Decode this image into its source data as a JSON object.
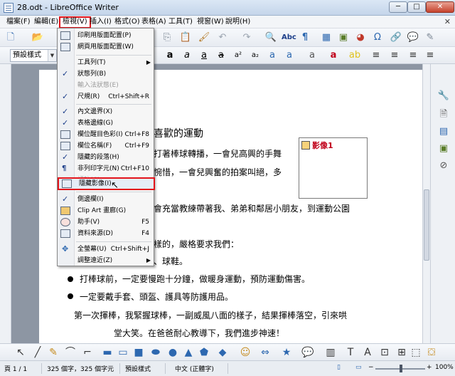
{
  "window": {
    "title": "28.odt - LibreOffice Writer",
    "minimize": "─",
    "maximize": "□",
    "close": "✕"
  },
  "menubar": {
    "items": [
      "檔案(F)",
      "編輯(E)",
      "檢視(V)",
      "插入(I)",
      "格式(O)",
      "表格(A)",
      "工具(T)",
      "視窗(W)",
      "說明(H)"
    ],
    "close_doc": "✕"
  },
  "toolbar2": {
    "style_value": "預設樣式"
  },
  "view_menu": {
    "items": [
      {
        "label": "印刷用版面配置(P)",
        "state": "icon"
      },
      {
        "label": "網頁用版面配置(W)",
        "state": "icon"
      },
      {
        "label": "工具列(T)",
        "state": "submenu"
      },
      {
        "label": "狀態列(B)",
        "state": "checked"
      },
      {
        "label": "輸入法狀態(E)",
        "state": "disabled"
      },
      {
        "label": "尺規(R)",
        "shortcut": "Ctrl+Shift+R",
        "state": "checked"
      },
      {
        "label": "內文邊界(X)",
        "state": "checked"
      },
      {
        "label": "表格邊線(G)",
        "state": "checked"
      },
      {
        "label": "欄位醒目色彩(I)",
        "shortcut": "Ctrl+F8",
        "state": "icon"
      },
      {
        "label": "欄位名稱(F)",
        "shortcut": "Ctrl+F9",
        "state": "icon"
      },
      {
        "label": "隱藏的段落(H)",
        "state": "checked"
      },
      {
        "label": "非列印字元(N)",
        "shortcut": "Ctrl+F10",
        "state": "icon"
      },
      {
        "label": "評註(C)",
        "state": "disabled"
      },
      {
        "label": "隱藏影像(I)",
        "state": "icon",
        "highlight": true
      },
      {
        "label": "側邊欄(I)",
        "state": "checked"
      },
      {
        "label": "Clip Art 畫廊(G)",
        "state": "icon"
      },
      {
        "label": "助手(V)",
        "shortcut": "F5",
        "state": "icon"
      },
      {
        "label": "資料來源(D)",
        "shortcut": "F4",
        "state": "icon"
      },
      {
        "label": "全螢幕(U)",
        "shortcut": "Ctrl+Shift+J",
        "state": "icon"
      },
      {
        "label": "調整遠近(Z)",
        "state": "submenu"
      }
    ]
  },
  "document": {
    "heading": "喜歡的運動",
    "lines": [
      "打著棒球轉播，一會兒高興的手舞",
      "惋惜，一會兒興奮的拍案叫絕，多",
      "會充當教練帶著我、弟弟和鄰居小朋友，到運動公園",
      "樣的，嚴格要求我們：",
      "、球鞋。",
      "打棒球前，一定要慢跑十分鐘，做暖身運動，預防運動傷害。",
      "一定要戴手套、頭盔、護具等防護用品。",
      "第一次揮棒，我緊握球棒，一副威風八面的樣子，結果揮棒落空，引來哄",
      "堂大笑。在爸爸耐心教導下，我們進步神速！"
    ],
    "margin_char_a": "小",
    "margin_char_b": "往",
    "image_caption": "影像1"
  },
  "status": {
    "page": "頁 1 / 1",
    "words": "325 個字，325 個字元",
    "style": "預設樣式",
    "language": "中文 (正體字)",
    "zoom": "100%"
  }
}
